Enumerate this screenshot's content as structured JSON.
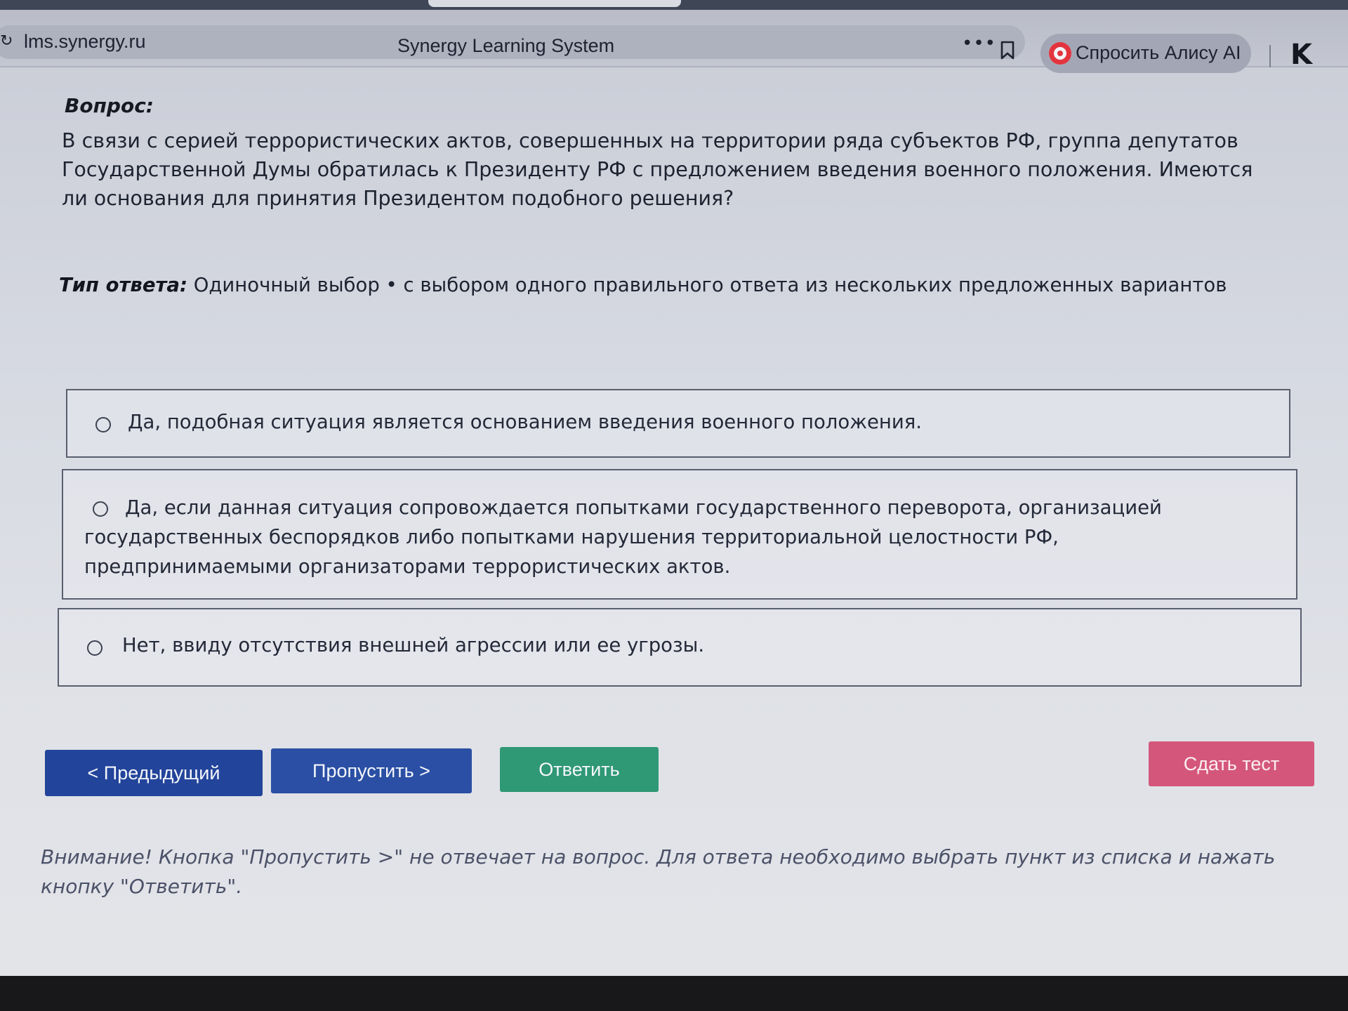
{
  "browser": {
    "url": "lms.synergy.ru",
    "page_title": "Synergy Learning System",
    "more_icon": "more-dots-icon",
    "bookmark_icon": "bookmark-icon",
    "alice_button_label": "Спросить Алису AI",
    "alice_icon": "alice-icon",
    "logo_icon": "k-logo-icon"
  },
  "question": {
    "label": "Вопрос:",
    "text": "В связи с серией террористических актов, совершенных на территории ряда субъектов РФ, группа депутатов Государственной Думы обратилась к Президенту РФ с предложением введения военного положения. Имеются ли основания для принятия Президентом подобного решения?",
    "answer_type_label": "Тип ответа:",
    "answer_type_value": "Одиночный выбор • с выбором одного правильного ответа из нескольких предложенных вариантов"
  },
  "options": [
    {
      "text": "Да, подобная ситуация является основанием введения военного положения.",
      "selected": false
    },
    {
      "text": "Да, если данная ситуация сопровождается попытками государственного переворота, организацией государственных беспорядков либо попытками нарушения территориальной целостности РФ, предпринимаемыми организаторами террористических актов.",
      "selected": false
    },
    {
      "text": "Нет, ввиду отсутствия внешней агрессии или ее угрозы.",
      "selected": false
    }
  ],
  "buttons": {
    "prev": "< Предыдущий",
    "skip": "Пропустить >",
    "answer": "Ответить",
    "submit": "Сдать тест"
  },
  "colors": {
    "prev_button": "#22449a",
    "skip_button": "#2a4fa4",
    "answer_button": "#2f9874",
    "submit_button": "#d4577b"
  },
  "warning": "Внимание! Кнопка \"Пропустить >\" не отвечает на вопрос. Для ответа необходимо выбрать пункт из списка и нажать кнопку \"Ответить\"."
}
